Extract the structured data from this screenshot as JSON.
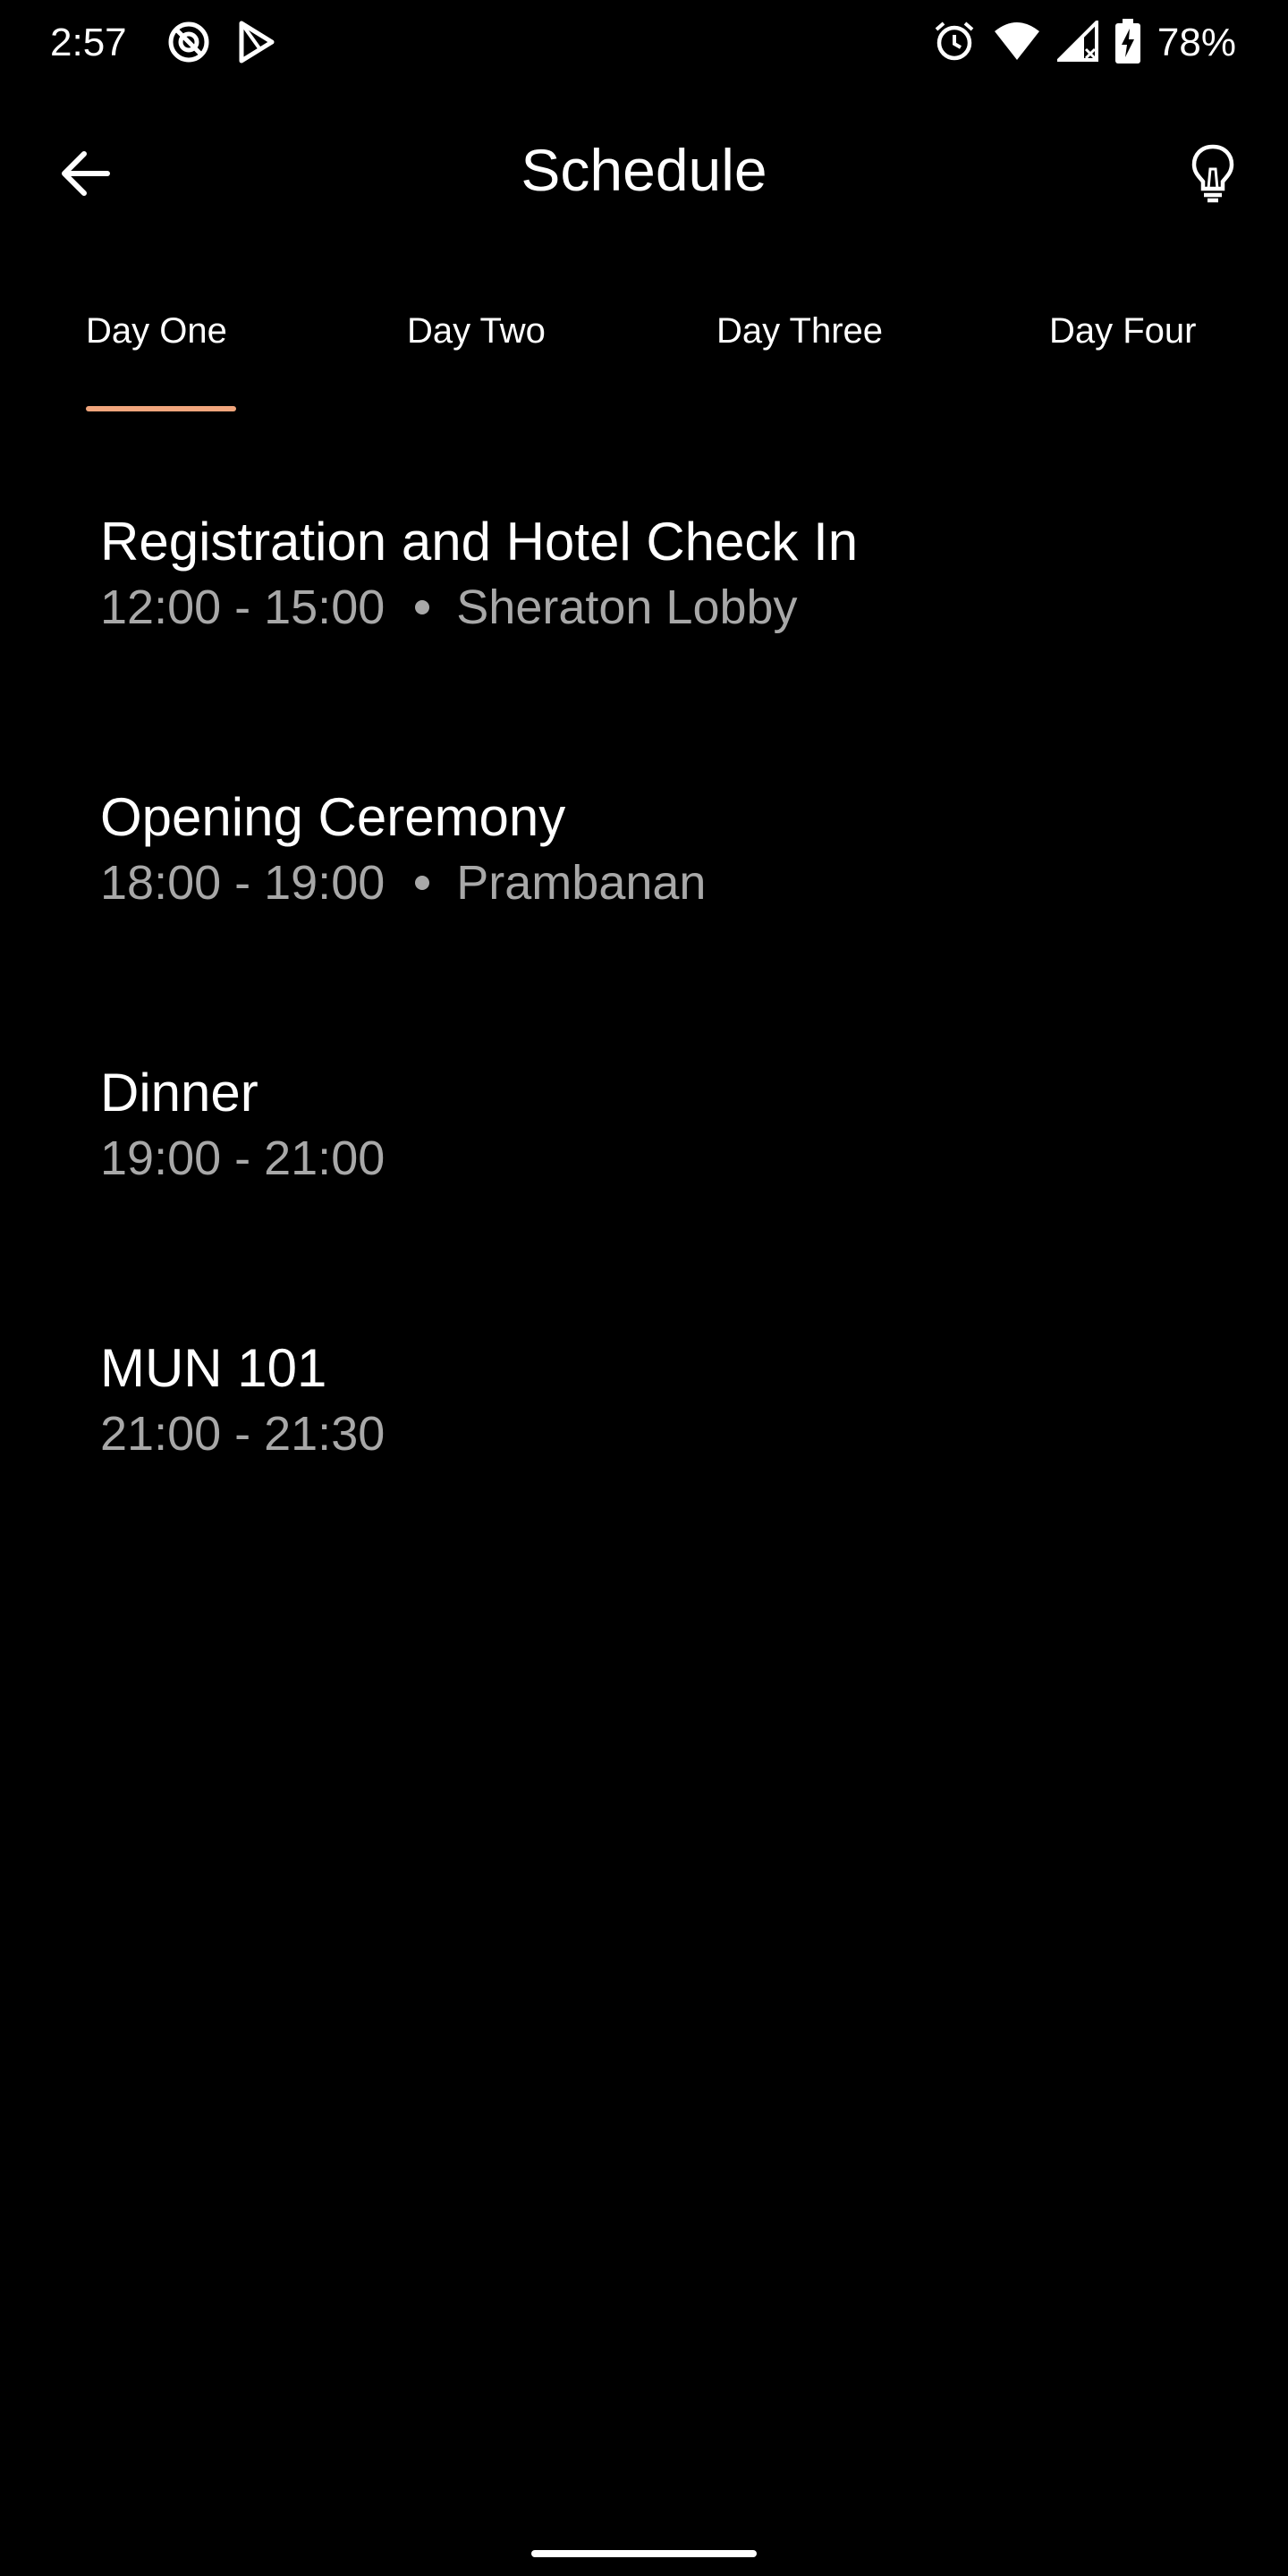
{
  "status_bar": {
    "time": "2:57",
    "battery": "78%",
    "icons": [
      "do-not-disturb-icon",
      "play-store-icon",
      "alarm-icon",
      "wifi-icon",
      "signal-icon",
      "battery-charging-icon"
    ]
  },
  "header": {
    "title": "Schedule",
    "back_icon": "arrow-left-icon",
    "tip_icon": "lightbulb-icon"
  },
  "tabs": [
    {
      "label": "Day One",
      "selected": true
    },
    {
      "label": "Day Two",
      "selected": false
    },
    {
      "label": "Day Three",
      "selected": false
    },
    {
      "label": "Day Four",
      "selected": false
    }
  ],
  "schedule": [
    {
      "title": "Registration and Hotel Check In",
      "time": "12:00 - 15:00",
      "location": "Sheraton Lobby"
    },
    {
      "title": "Opening Ceremony",
      "time": "18:00 - 19:00",
      "location": "Prambanan"
    },
    {
      "title": "Dinner",
      "time": "19:00 - 21:00"
    },
    {
      "title": "MUN 101",
      "time": "21:00 - 21:30"
    }
  ],
  "colors": {
    "background": "#000000",
    "accent": "#f0a57c",
    "primary_text": "#ffffff",
    "secondary_text": "#a8a8a8"
  }
}
